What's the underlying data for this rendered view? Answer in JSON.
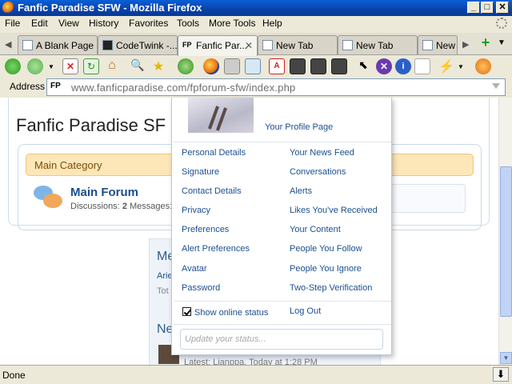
{
  "window": {
    "title": "Fanfic Paradise SFW - Mozilla Firefox"
  },
  "menu": [
    "File",
    "Edit",
    "View",
    "History",
    "Favorites",
    "Tools",
    "More Tools",
    "Help"
  ],
  "tabs": [
    {
      "label": "A Blank Page",
      "active": false
    },
    {
      "label": "CodeTwink -...",
      "active": false
    },
    {
      "label": "Fanfic Par...",
      "active": true
    },
    {
      "label": "New Tab",
      "active": false
    },
    {
      "label": "New Tab",
      "active": false
    },
    {
      "label": "New",
      "active": false
    }
  ],
  "address": {
    "label": "Address",
    "favicon": "FP",
    "url": "www.fanficparadise.com/fpforum-sfw/index.php"
  },
  "page": {
    "title": "Fanfic Paradise SF",
    "category": "Main Category",
    "forum_name": "Main Forum",
    "forum_stats": {
      "discussions_label": "Discussions:",
      "discussions": "2",
      "messages_label": "Messages:"
    },
    "side_heading_1": "Me",
    "side_heading_2": "Ne",
    "side_line_1": "Arie",
    "side_line_2": "Tot",
    "latest": "Latest: Lianppa, Today at 1:28 PM"
  },
  "popup": {
    "profile_link": "Your Profile Page",
    "left_links": [
      "Personal Details",
      "Signature",
      "Contact Details",
      "Privacy",
      "Preferences",
      "Alert Preferences",
      "Avatar",
      "Password"
    ],
    "right_links": [
      "Your News Feed",
      "Conversations",
      "Alerts",
      "Likes You've Received",
      "Your Content",
      "People You Follow",
      "People You Ignore",
      "Two-Step Verification"
    ],
    "show_online_label": "Show online status",
    "show_online_checked": true,
    "logout": "Log Out",
    "status_placeholder": "Update your status..."
  },
  "statusbar": {
    "text": "Done"
  }
}
